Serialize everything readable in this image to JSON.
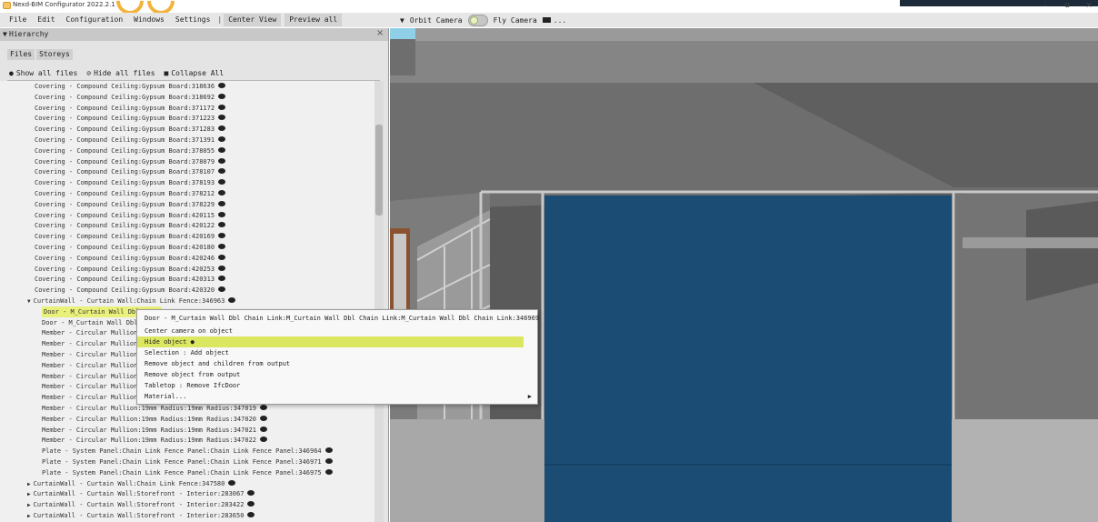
{
  "window": {
    "title": "Nexd-BIM Configurator 2022.2.1",
    "controls": {
      "minimize": "–",
      "maximize": "ɑ",
      "close": "×"
    }
  },
  "menubar": {
    "items": [
      "File",
      "Edit",
      "Configuration",
      "Windows",
      "Settings"
    ],
    "separator": "|",
    "buttons": [
      "Center View",
      "Preview all"
    ]
  },
  "viewport_toolbar": {
    "orbit_label": "Orbit Camera",
    "fly_label": "Fly Camera",
    "more": "..."
  },
  "hierarchy": {
    "title": "Hierarchy",
    "close": "×",
    "tabs": [
      "Files",
      "Storeys"
    ],
    "actions": {
      "show_all": "Show all files",
      "hide_all": "Hide all files",
      "collapse_all": "Collapse All"
    },
    "rows": [
      {
        "text": "Covering - Compound Ceiling:Gypsum Board:318636",
        "indent": 40,
        "eye": true
      },
      {
        "text": "Covering - Compound Ceiling:Gypsum Board:318692",
        "indent": 40,
        "eye": true
      },
      {
        "text": "Covering - Compound Ceiling:Gypsum Board:371172",
        "indent": 40,
        "eye": true
      },
      {
        "text": "Covering - Compound Ceiling:Gypsum Board:371223",
        "indent": 40,
        "eye": true
      },
      {
        "text": "Covering - Compound Ceiling:Gypsum Board:371283",
        "indent": 40,
        "eye": true
      },
      {
        "text": "Covering - Compound Ceiling:Gypsum Board:371391",
        "indent": 40,
        "eye": true
      },
      {
        "text": "Covering - Compound Ceiling:Gypsum Board:378055",
        "indent": 40,
        "eye": true
      },
      {
        "text": "Covering - Compound Ceiling:Gypsum Board:378079",
        "indent": 40,
        "eye": true
      },
      {
        "text": "Covering - Compound Ceiling:Gypsum Board:378107",
        "indent": 40,
        "eye": true
      },
      {
        "text": "Covering - Compound Ceiling:Gypsum Board:378193",
        "indent": 40,
        "eye": true
      },
      {
        "text": "Covering - Compound Ceiling:Gypsum Board:378212",
        "indent": 40,
        "eye": true
      },
      {
        "text": "Covering - Compound Ceiling:Gypsum Board:378229",
        "indent": 40,
        "eye": true
      },
      {
        "text": "Covering - Compound Ceiling:Gypsum Board:420115",
        "indent": 40,
        "eye": true
      },
      {
        "text": "Covering - Compound Ceiling:Gypsum Board:420122",
        "indent": 40,
        "eye": true
      },
      {
        "text": "Covering - Compound Ceiling:Gypsum Board:420169",
        "indent": 40,
        "eye": true
      },
      {
        "text": "Covering - Compound Ceiling:Gypsum Board:420180",
        "indent": 40,
        "eye": true
      },
      {
        "text": "Covering - Compound Ceiling:Gypsum Board:420246",
        "indent": 40,
        "eye": true
      },
      {
        "text": "Covering - Compound Ceiling:Gypsum Board:420253",
        "indent": 40,
        "eye": true
      },
      {
        "text": "Covering - Compound Ceiling:Gypsum Board:420313",
        "indent": 40,
        "eye": true
      },
      {
        "text": "Covering - Compound Ceiling:Gypsum Board:420320",
        "indent": 40,
        "eye": true
      },
      {
        "text": "CurtainWall - Curtain Wall:Chain Link Fence:346963",
        "indent": 32,
        "eye": true,
        "caret": "▼"
      },
      {
        "text": "Door - M_Curtain Wall Dbl",
        "indent": 48,
        "eye": false,
        "highlight": true
      },
      {
        "text": "Door - M_Curtain Wall Dbl",
        "indent": 48,
        "eye": false
      },
      {
        "text": "Member - Circular Mullion",
        "indent": 48,
        "eye": false
      },
      {
        "text": "Member - Circular Mullion",
        "indent": 48,
        "eye": false
      },
      {
        "text": "Member - Circular Mullion",
        "indent": 48,
        "eye": false
      },
      {
        "text": "Member - Circular Mullion",
        "indent": 48,
        "eye": false
      },
      {
        "text": "Member - Circular Mullion",
        "indent": 48,
        "eye": false
      },
      {
        "text": "Member - Circular Mullion",
        "indent": 48,
        "eye": false
      },
      {
        "text": "Member - Circular Mullion",
        "indent": 48,
        "eye": false
      },
      {
        "text": "Member - Circular Mullion:19mm Radius:19mm Radius:347019",
        "indent": 48,
        "eye": true
      },
      {
        "text": "Member - Circular Mullion:19mm Radius:19mm Radius:347020",
        "indent": 48,
        "eye": true
      },
      {
        "text": "Member - Circular Mullion:19mm Radius:19mm Radius:347021",
        "indent": 48,
        "eye": true
      },
      {
        "text": "Member - Circular Mullion:19mm Radius:19mm Radius:347022",
        "indent": 48,
        "eye": true
      },
      {
        "text": "Plate - System Panel:Chain Link Fence Panel:Chain Link Fence Panel:346964",
        "indent": 48,
        "eye": true
      },
      {
        "text": "Plate - System Panel:Chain Link Fence Panel:Chain Link Fence Panel:346971",
        "indent": 48,
        "eye": true
      },
      {
        "text": "Plate - System Panel:Chain Link Fence Panel:Chain Link Fence Panel:346975",
        "indent": 48,
        "eye": true
      },
      {
        "text": "CurtainWall - Curtain Wall:Chain Link Fence:347580",
        "indent": 32,
        "eye": true,
        "caret": "▶"
      },
      {
        "text": "CurtainWall - Curtain Wall:Storefront - Interior:283067",
        "indent": 32,
        "eye": true,
        "caret": "▶"
      },
      {
        "text": "CurtainWall - Curtain Wall:Storefront - Interior:283422",
        "indent": 32,
        "eye": true,
        "caret": "▶"
      },
      {
        "text": "CurtainWall - Curtain Wall:Storefront - Interior:283650",
        "indent": 32,
        "eye": true,
        "caret": "▶"
      }
    ]
  },
  "context_menu": {
    "header": "Door - M_Curtain Wall Dbl Chain Link:M_Curtain Wall Dbl Chain Link:M_Curtain Wall Dbl Chain Link:346969",
    "items": [
      {
        "label": "Center camera on object"
      },
      {
        "label": "Hide object",
        "highlight": true,
        "eye": true
      },
      {
        "label": "Selection : Add object"
      },
      {
        "label": "Remove object and children from output"
      },
      {
        "label": "Remove object from output"
      },
      {
        "label": "Tabletop : Remove IfcDoor"
      },
      {
        "label": "Material...",
        "submenu": true
      }
    ]
  },
  "colors": {
    "highlight": "#e9f17a",
    "door_panel": "#1b4c73",
    "sky": "#8fd0e8"
  }
}
